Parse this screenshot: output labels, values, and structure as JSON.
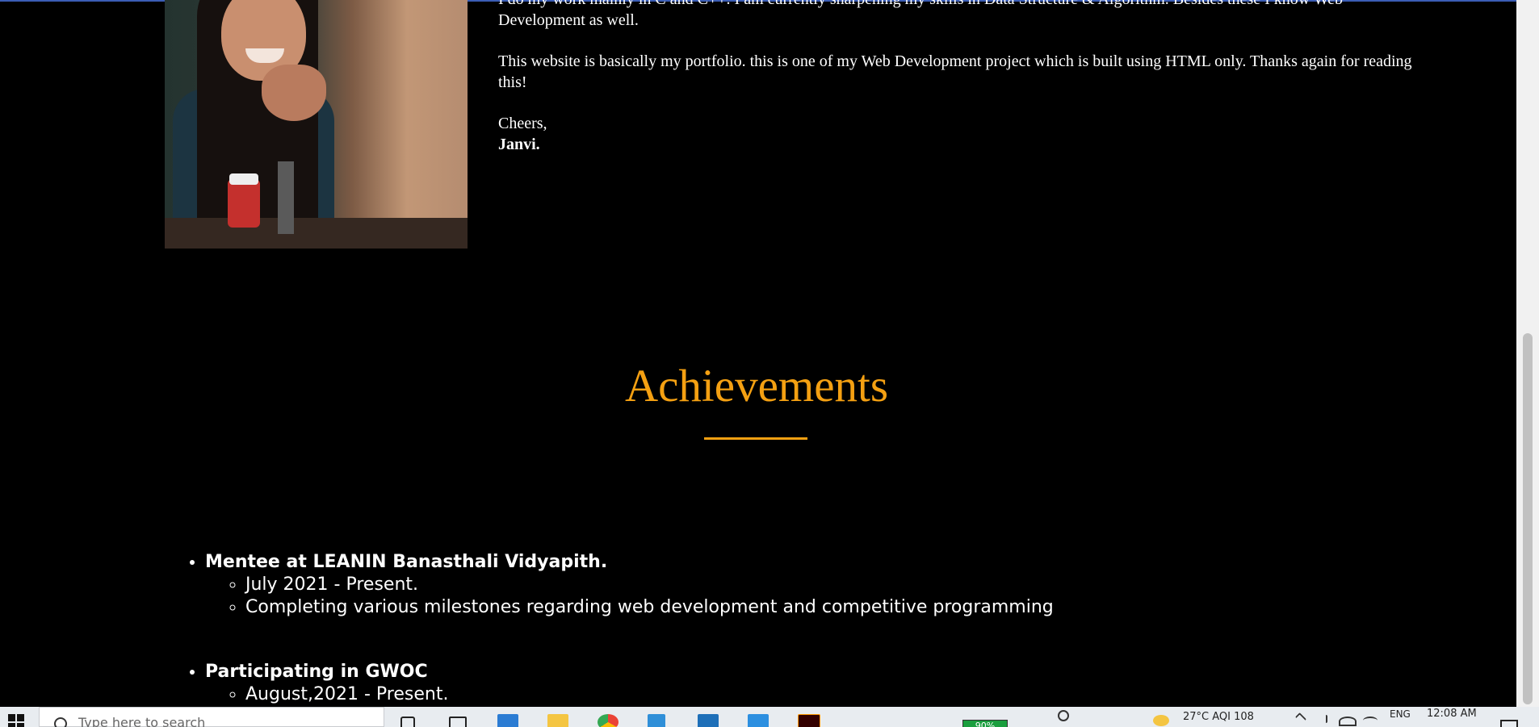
{
  "about": {
    "paragraphs": [
      "I do my work mainly in C and C++. I am currently sharpening my skills in Data Structure & Algorithm. Besides these I know Web Development as well.",
      "This website is basically my portfolio. this is one of my Web Development project which is built using HTML only. Thanks again for reading this!"
    ],
    "closing": "Cheers,",
    "signature": "Janvi."
  },
  "achievements": {
    "title": "Achievements",
    "accent_color": "#f4a012",
    "items": [
      {
        "title": "Mentee at LEANIN Banasthali Vidyapith.",
        "details": [
          "July 2021 - Present.",
          "Completing various milestones regarding web development and competitive programming"
        ]
      },
      {
        "title": "Participating in GWOC",
        "details": [
          "August,2021 - Present."
        ]
      }
    ]
  },
  "taskbar": {
    "search_placeholder": "Type here to search",
    "battery": "90%",
    "weather": "27°C  AQI 108",
    "language": "ENG",
    "time": "12:08 AM",
    "icons": [
      "task-view-icon",
      "edge-icon",
      "file-explorer-icon",
      "chrome-icon",
      "bookmark-app-icon",
      "mail-icon",
      "vscode-icon",
      "illustrator-icon"
    ]
  }
}
